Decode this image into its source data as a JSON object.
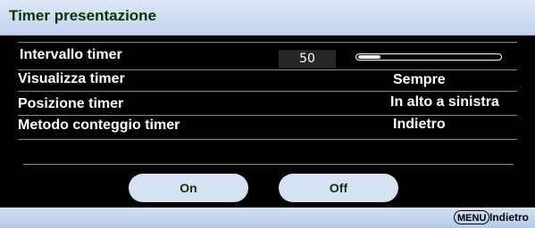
{
  "title": "Timer presentazione",
  "rows": [
    {
      "label": "Intervallo timer",
      "value": "50",
      "slider_fraction": 0.16
    },
    {
      "label": "Visualizza timer",
      "value": "Sempre"
    },
    {
      "label": "Posizione timer",
      "value": "In alto a sinistra"
    },
    {
      "label": "Metodo conteggio timer",
      "value": "Indietro"
    }
  ],
  "buttons": {
    "on": "On",
    "off": "Off"
  },
  "footer": {
    "menu_key": "MENU",
    "back": "Indietro"
  },
  "colors": {
    "title_bg": "#d0ddf1",
    "title_text": "#083306",
    "button_bg": "#d5e2f4",
    "background": "#000000"
  }
}
